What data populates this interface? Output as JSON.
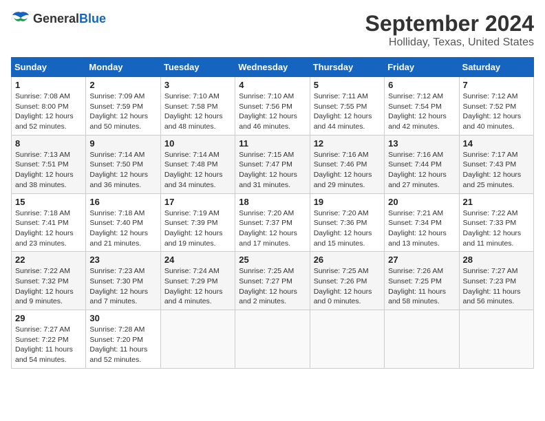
{
  "logo": {
    "general": "General",
    "blue": "Blue"
  },
  "header": {
    "month_year": "September 2024",
    "location": "Holliday, Texas, United States"
  },
  "weekdays": [
    "Sunday",
    "Monday",
    "Tuesday",
    "Wednesday",
    "Thursday",
    "Friday",
    "Saturday"
  ],
  "weeks": [
    [
      {
        "day": "1",
        "sunrise": "Sunrise: 7:08 AM",
        "sunset": "Sunset: 8:00 PM",
        "daylight": "Daylight: 12 hours and 52 minutes."
      },
      {
        "day": "2",
        "sunrise": "Sunrise: 7:09 AM",
        "sunset": "Sunset: 7:59 PM",
        "daylight": "Daylight: 12 hours and 50 minutes."
      },
      {
        "day": "3",
        "sunrise": "Sunrise: 7:10 AM",
        "sunset": "Sunset: 7:58 PM",
        "daylight": "Daylight: 12 hours and 48 minutes."
      },
      {
        "day": "4",
        "sunrise": "Sunrise: 7:10 AM",
        "sunset": "Sunset: 7:56 PM",
        "daylight": "Daylight: 12 hours and 46 minutes."
      },
      {
        "day": "5",
        "sunrise": "Sunrise: 7:11 AM",
        "sunset": "Sunset: 7:55 PM",
        "daylight": "Daylight: 12 hours and 44 minutes."
      },
      {
        "day": "6",
        "sunrise": "Sunrise: 7:12 AM",
        "sunset": "Sunset: 7:54 PM",
        "daylight": "Daylight: 12 hours and 42 minutes."
      },
      {
        "day": "7",
        "sunrise": "Sunrise: 7:12 AM",
        "sunset": "Sunset: 7:52 PM",
        "daylight": "Daylight: 12 hours and 40 minutes."
      }
    ],
    [
      {
        "day": "8",
        "sunrise": "Sunrise: 7:13 AM",
        "sunset": "Sunset: 7:51 PM",
        "daylight": "Daylight: 12 hours and 38 minutes."
      },
      {
        "day": "9",
        "sunrise": "Sunrise: 7:14 AM",
        "sunset": "Sunset: 7:50 PM",
        "daylight": "Daylight: 12 hours and 36 minutes."
      },
      {
        "day": "10",
        "sunrise": "Sunrise: 7:14 AM",
        "sunset": "Sunset: 7:48 PM",
        "daylight": "Daylight: 12 hours and 34 minutes."
      },
      {
        "day": "11",
        "sunrise": "Sunrise: 7:15 AM",
        "sunset": "Sunset: 7:47 PM",
        "daylight": "Daylight: 12 hours and 31 minutes."
      },
      {
        "day": "12",
        "sunrise": "Sunrise: 7:16 AM",
        "sunset": "Sunset: 7:46 PM",
        "daylight": "Daylight: 12 hours and 29 minutes."
      },
      {
        "day": "13",
        "sunrise": "Sunrise: 7:16 AM",
        "sunset": "Sunset: 7:44 PM",
        "daylight": "Daylight: 12 hours and 27 minutes."
      },
      {
        "day": "14",
        "sunrise": "Sunrise: 7:17 AM",
        "sunset": "Sunset: 7:43 PM",
        "daylight": "Daylight: 12 hours and 25 minutes."
      }
    ],
    [
      {
        "day": "15",
        "sunrise": "Sunrise: 7:18 AM",
        "sunset": "Sunset: 7:41 PM",
        "daylight": "Daylight: 12 hours and 23 minutes."
      },
      {
        "day": "16",
        "sunrise": "Sunrise: 7:18 AM",
        "sunset": "Sunset: 7:40 PM",
        "daylight": "Daylight: 12 hours and 21 minutes."
      },
      {
        "day": "17",
        "sunrise": "Sunrise: 7:19 AM",
        "sunset": "Sunset: 7:39 PM",
        "daylight": "Daylight: 12 hours and 19 minutes."
      },
      {
        "day": "18",
        "sunrise": "Sunrise: 7:20 AM",
        "sunset": "Sunset: 7:37 PM",
        "daylight": "Daylight: 12 hours and 17 minutes."
      },
      {
        "day": "19",
        "sunrise": "Sunrise: 7:20 AM",
        "sunset": "Sunset: 7:36 PM",
        "daylight": "Daylight: 12 hours and 15 minutes."
      },
      {
        "day": "20",
        "sunrise": "Sunrise: 7:21 AM",
        "sunset": "Sunset: 7:34 PM",
        "daylight": "Daylight: 12 hours and 13 minutes."
      },
      {
        "day": "21",
        "sunrise": "Sunrise: 7:22 AM",
        "sunset": "Sunset: 7:33 PM",
        "daylight": "Daylight: 12 hours and 11 minutes."
      }
    ],
    [
      {
        "day": "22",
        "sunrise": "Sunrise: 7:22 AM",
        "sunset": "Sunset: 7:32 PM",
        "daylight": "Daylight: 12 hours and 9 minutes."
      },
      {
        "day": "23",
        "sunrise": "Sunrise: 7:23 AM",
        "sunset": "Sunset: 7:30 PM",
        "daylight": "Daylight: 12 hours and 7 minutes."
      },
      {
        "day": "24",
        "sunrise": "Sunrise: 7:24 AM",
        "sunset": "Sunset: 7:29 PM",
        "daylight": "Daylight: 12 hours and 4 minutes."
      },
      {
        "day": "25",
        "sunrise": "Sunrise: 7:25 AM",
        "sunset": "Sunset: 7:27 PM",
        "daylight": "Daylight: 12 hours and 2 minutes."
      },
      {
        "day": "26",
        "sunrise": "Sunrise: 7:25 AM",
        "sunset": "Sunset: 7:26 PM",
        "daylight": "Daylight: 12 hours and 0 minutes."
      },
      {
        "day": "27",
        "sunrise": "Sunrise: 7:26 AM",
        "sunset": "Sunset: 7:25 PM",
        "daylight": "Daylight: 11 hours and 58 minutes."
      },
      {
        "day": "28",
        "sunrise": "Sunrise: 7:27 AM",
        "sunset": "Sunset: 7:23 PM",
        "daylight": "Daylight: 11 hours and 56 minutes."
      }
    ],
    [
      {
        "day": "29",
        "sunrise": "Sunrise: 7:27 AM",
        "sunset": "Sunset: 7:22 PM",
        "daylight": "Daylight: 11 hours and 54 minutes."
      },
      {
        "day": "30",
        "sunrise": "Sunrise: 7:28 AM",
        "sunset": "Sunset: 7:20 PM",
        "daylight": "Daylight: 11 hours and 52 minutes."
      },
      null,
      null,
      null,
      null,
      null
    ]
  ]
}
